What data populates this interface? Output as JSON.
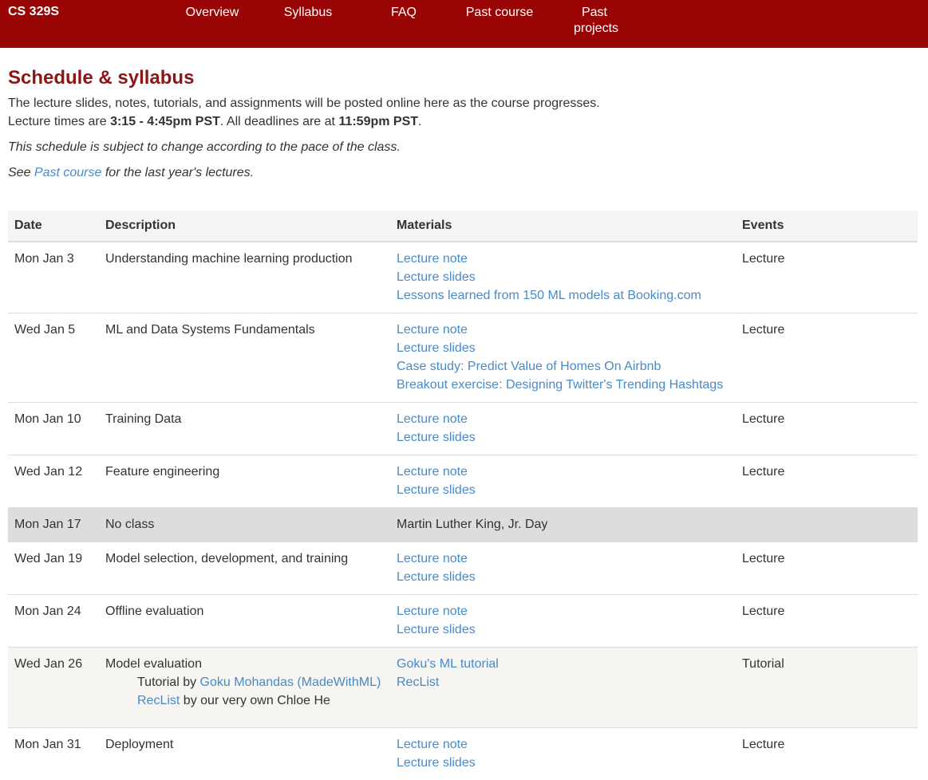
{
  "navbar": {
    "brand": "CS 329S",
    "items": [
      "Overview",
      "Syllabus",
      "FAQ",
      "Past course",
      "Past projects"
    ],
    "bg_color": "#990505"
  },
  "page": {
    "title": "Schedule & syllabus",
    "intro": "The lecture slides, notes, tutorials, and assignments will be posted online here as the course progresses.",
    "times_prefix": "Lecture times are ",
    "lecture_time": "3:15 - 4:45pm PST",
    "times_middle": ". All deadlines are at ",
    "deadline_time": "11:59pm PST",
    "times_suffix": ".",
    "disclaimer": "This schedule is subject to change according to the pace of the class.",
    "see_prefix": "See ",
    "see_link": "Past course",
    "see_suffix": " for the last year's lectures."
  },
  "table": {
    "headers": [
      "Date",
      "Description",
      "Materials",
      "Events"
    ],
    "rows": [
      {
        "date": "Mon Jan 3",
        "desc": "Understanding machine learning production",
        "materials": [
          "Lecture note",
          "Lecture slides",
          "Lessons learned from 150 ML models at Booking.com"
        ],
        "event": "Lecture"
      },
      {
        "date": "Wed Jan 5",
        "desc": "ML and Data Systems Fundamentals",
        "materials": [
          "Lecture note",
          "Lecture slides",
          "Case study: Predict Value of Homes On Airbnb",
          "Breakout exercise: Designing Twitter's Trending Hashtags"
        ],
        "event": "Lecture"
      },
      {
        "date": "Mon Jan 10",
        "desc": "Training Data",
        "materials": [
          "Lecture note",
          "Lecture slides"
        ],
        "event": "Lecture"
      },
      {
        "date": "Wed Jan 12",
        "desc": "Feature engineering",
        "materials": [
          "Lecture note",
          "Lecture slides"
        ],
        "event": "Lecture"
      },
      {
        "date": "Mon Jan 17",
        "desc": "No class",
        "note": "Martin Luther King, Jr. Day",
        "event": ""
      },
      {
        "date": "Wed Jan 19",
        "desc": "Model selection, development, and training",
        "materials": [
          "Lecture note",
          "Lecture slides"
        ],
        "event": "Lecture"
      },
      {
        "date": "Mon Jan 24",
        "desc": "Offline evaluation",
        "materials": [
          "Lecture note",
          "Lecture slides"
        ],
        "event": "Lecture"
      },
      {
        "date": "Wed Jan 26",
        "desc": "Model evaluation",
        "sub1_prefix": "Tutorial by ",
        "sub1_link": "Goku Mohandas (MadeWithML)",
        "sub2_link": "RecList",
        "sub2_suffix": " by our very own Chloe He",
        "materials": [
          "Goku's ML tutorial",
          "RecList"
        ],
        "event": "Tutorial"
      },
      {
        "date": "Mon Jan 31",
        "desc": "Deployment",
        "materials": [
          "Lecture note",
          "Lecture slides"
        ],
        "event": "Lecture"
      }
    ]
  }
}
